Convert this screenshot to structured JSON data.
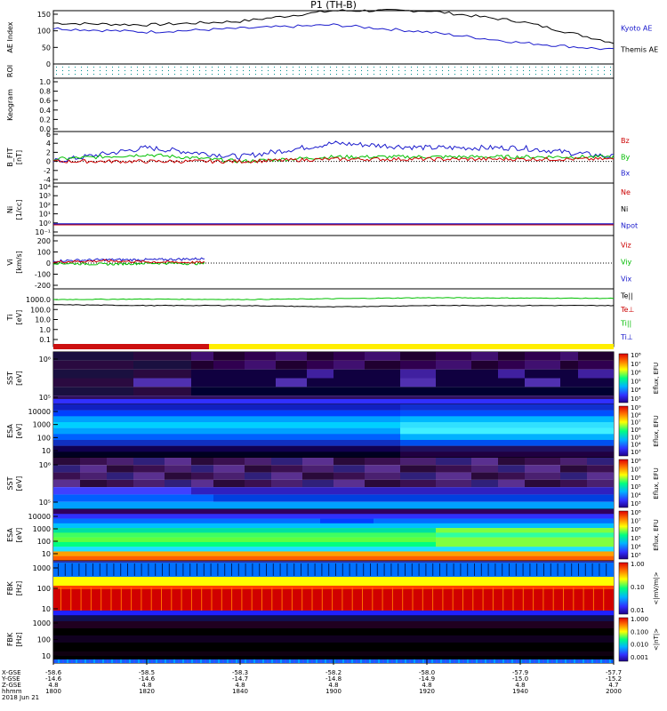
{
  "title": "P1 (TH-B)",
  "panels": {
    "ae": {
      "ylabel": "AE Index",
      "ticks": [
        "150",
        "100",
        "50",
        "0"
      ],
      "legend": [
        {
          "text": "Kyoto AE",
          "color": "#1a1acc"
        },
        {
          "text": "Themis AE",
          "color": "#000000"
        }
      ]
    },
    "roi": {
      "ylabel": "ROI"
    },
    "keo": {
      "ylabel": "Keogram",
      "ticks": [
        "1.0",
        "0.8",
        "0.6",
        "0.4",
        "0.2",
        "0.0"
      ]
    },
    "bfit": {
      "ylabel": "B_FIT\n[nT]",
      "ticks": [
        "6",
        "4",
        "2",
        "0",
        "-2",
        "-4"
      ],
      "legend": [
        {
          "text": "Bz",
          "color": "#cc0000"
        },
        {
          "text": "By",
          "color": "#00bb00"
        },
        {
          "text": "Bx",
          "color": "#1a1acc"
        }
      ]
    },
    "ni": {
      "ylabel": "Ni\n[1/cc]",
      "ticks": [
        "10⁴",
        "10³",
        "10²",
        "10¹",
        "10⁰",
        "10⁻¹"
      ],
      "legend": [
        {
          "text": "Ne",
          "color": "#cc0000"
        },
        {
          "text": "Ni",
          "color": "#000000"
        },
        {
          "text": "Npot",
          "color": "#1a1acc"
        }
      ]
    },
    "vi": {
      "ylabel": "Vi\n[km/s]",
      "ticks": [
        "200",
        "100",
        "0",
        "-100",
        "-200"
      ],
      "legend": [
        {
          "text": "Viz",
          "color": "#cc0000"
        },
        {
          "text": "Viy",
          "color": "#00bb00"
        },
        {
          "text": "Vix",
          "color": "#1a1acc"
        }
      ]
    },
    "ti": {
      "ylabel": "Ti\n[eV]",
      "ticks": [
        "1000.0",
        "100.0",
        "10.0",
        "1.0",
        "0.1"
      ],
      "legend": [
        {
          "text": "Te||",
          "color": "#000000"
        },
        {
          "text": "Te⊥",
          "color": "#cc0000"
        },
        {
          "text": "Ti||",
          "color": "#00bb00"
        },
        {
          "text": "Ti⊥",
          "color": "#1a1acc"
        }
      ]
    },
    "sst_e": {
      "ylabel": "SST\n[eV]",
      "ticks": [
        "10⁶",
        "10⁵"
      ],
      "cbar_ticks": [
        "10⁸",
        "10⁷",
        "10⁶",
        "10⁵",
        "10⁴",
        "10³"
      ],
      "cbar_label": "Eflux, EFU"
    },
    "esa_e": {
      "ylabel": "ESA\n[eV]",
      "ticks": [
        "10000",
        "1000",
        "100",
        "10"
      ],
      "cbar_ticks": [
        "10⁹",
        "10⁸",
        "10⁷",
        "10⁶",
        "10⁵",
        "10⁴",
        "10³"
      ],
      "cbar_label": "Eflux, EFU"
    },
    "sst_i": {
      "ylabel": "SST\n[eV]",
      "ticks": [
        "10⁶",
        "10⁵"
      ],
      "cbar_ticks": [
        "10⁸",
        "10⁷",
        "10⁶",
        "10⁵",
        "10⁴",
        "10³"
      ],
      "cbar_label": "Eflux, EFU"
    },
    "esa_i": {
      "ylabel": "ESA\n[eV]",
      "ticks": [
        "10000",
        "1000",
        "100",
        "10"
      ],
      "cbar_ticks": [
        "10⁸",
        "10⁷",
        "10⁶",
        "10⁵",
        "10⁴",
        "10³"
      ],
      "cbar_label": "Eflux, EFU"
    },
    "fbk1": {
      "ylabel": "FBK\n[Hz]",
      "ticks": [
        "1000",
        "100",
        "10"
      ],
      "cbar_ticks": [
        "1.00",
        "0.10",
        "0.01"
      ],
      "cbar_label": "<|mV/m|>"
    },
    "fbk2": {
      "ylabel": "FBK\n[Hz]",
      "ticks": [
        "1000",
        "100",
        "10"
      ],
      "cbar_ticks": [
        "1.000",
        "0.100",
        "0.010",
        "0.001"
      ],
      "cbar_label": "<|nT|>"
    }
  },
  "footer": {
    "row_labels": [
      "X-GSE",
      "Y-GSE",
      "Z-GSE",
      "hhmm",
      "2018 Jun 21"
    ],
    "columns": [
      {
        "x": "-58.6",
        "y": "-14.6",
        "z": "4.8",
        "t": "1800"
      },
      {
        "x": "-58.5",
        "y": "-14.6",
        "z": "4.8",
        "t": "1820"
      },
      {
        "x": "-58.3",
        "y": "-14.7",
        "z": "4.8",
        "t": "1840"
      },
      {
        "x": "-58.2",
        "y": "-14.8",
        "z": "4.8",
        "t": "1900"
      },
      {
        "x": "-58.0",
        "y": "-14.9",
        "z": "4.8",
        "t": "1920"
      },
      {
        "x": "-57.9",
        "y": "-15.0",
        "z": "4.8",
        "t": "1940"
      },
      {
        "x": "-57.7",
        "y": "-15.2",
        "z": "4.7",
        "t": "2000"
      }
    ]
  },
  "chart_data": [
    {
      "type": "line",
      "title": "P1 (TH-B)",
      "ylabel": "AE Index",
      "ylim": [
        0,
        150
      ],
      "x": [
        "18:00",
        "18:20",
        "18:40",
        "19:00",
        "19:20",
        "19:40",
        "20:00"
      ],
      "series": [
        {
          "name": "Themis AE",
          "values": [
            115,
            110,
            120,
            150,
            150,
            120,
            60
          ]
        },
        {
          "name": "Kyoto AE",
          "values": [
            100,
            90,
            100,
            110,
            90,
            60,
            40
          ]
        }
      ]
    },
    {
      "type": "line",
      "ylabel": "B_FIT [nT]",
      "ylim": [
        -4,
        6
      ],
      "x": [
        "18:00",
        "18:20",
        "18:40",
        "19:00",
        "19:20",
        "19:40",
        "20:00"
      ],
      "series": [
        {
          "name": "Bx",
          "values": [
            0,
            3,
            1,
            4,
            3,
            3,
            1
          ]
        },
        {
          "name": "By",
          "values": [
            0.5,
            1.5,
            0,
            1,
            1,
            1,
            1
          ]
        },
        {
          "name": "Bz",
          "values": [
            0,
            0,
            0,
            0.5,
            0.5,
            0.5,
            0.5
          ]
        }
      ]
    },
    {
      "type": "line",
      "ylabel": "Vi [km/s]",
      "ylim": [
        -250,
        250
      ],
      "x": [
        "18:00",
        "18:10",
        "18:20",
        "18:30"
      ],
      "series": [
        {
          "name": "Vix",
          "values": [
            20,
            30,
            30,
            40
          ]
        },
        {
          "name": "Viy",
          "values": [
            0,
            -10,
            0,
            -5
          ]
        },
        {
          "name": "Viz",
          "values": [
            10,
            20,
            10,
            5
          ]
        }
      ]
    },
    {
      "type": "line",
      "ylabel": "Ti [eV]",
      "ylim": [
        0.1,
        3000
      ],
      "x": [
        "18:00",
        "18:20",
        "18:40",
        "19:00",
        "19:20",
        "19:40",
        "20:00"
      ],
      "series": [
        {
          "name": "Ti||",
          "values": [
            1000,
            1100,
            1000,
            1200,
            1500,
            1400,
            1300
          ]
        },
        {
          "name": "Te||",
          "values": [
            300,
            250,
            250,
            180,
            250,
            250,
            250
          ]
        }
      ]
    }
  ]
}
